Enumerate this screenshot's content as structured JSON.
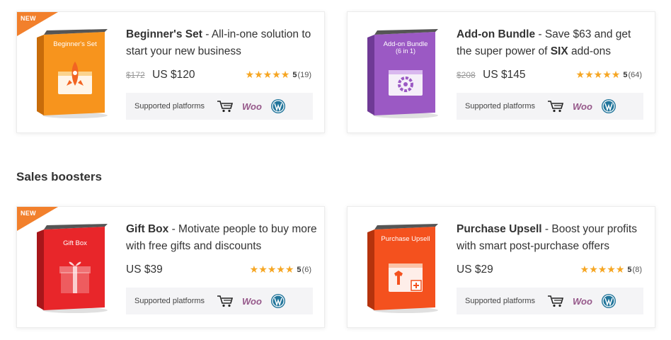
{
  "products_top": [
    {
      "badge": "NEW",
      "box_title": "Beginner's Set",
      "box_subtitle": "",
      "box_color": "#f7941d",
      "name": "Beginner's Set",
      "description": " - All-in-one solution to start your new business",
      "old_price": "$172",
      "price": "US $120",
      "rating": "5",
      "reviews": "(19)",
      "platforms_label": "Supported platforms",
      "icon": "rocket-icon"
    },
    {
      "badge": "",
      "box_title": "Add-on Bundle",
      "box_subtitle": "(6 in 1)",
      "box_color": "#9b59c4",
      "name": "Add-on Bundle",
      "description_pre": " - Save $63 and get the super power of ",
      "description_bold": "SIX",
      "description_post": " add-ons",
      "old_price": "$208",
      "price": "US $145",
      "rating": "5",
      "reviews": "(64)",
      "platforms_label": "Supported platforms",
      "icon": "gear-icon"
    }
  ],
  "section_title": "Sales boosters",
  "products_bottom": [
    {
      "badge": "NEW",
      "box_title": "Gift Box",
      "box_color": "#e8262a",
      "name": "Gift Box",
      "description": " - Motivate people to buy more with free gifts and discounts",
      "price": "US $39",
      "rating": "5",
      "reviews": "(6)",
      "platforms_label": "Supported platforms",
      "icon": "gift-icon"
    },
    {
      "badge": "",
      "box_title": "Purchase Upsell",
      "box_color": "#f4511e",
      "name": "Purchase Upsell",
      "description": " - Boost your profits with smart post-purchase offers",
      "price": "US $29",
      "rating": "5",
      "reviews": "(8)",
      "platforms_label": "Supported platforms",
      "icon": "shirt-icon"
    }
  ],
  "platform_labels": {
    "woo": "Woo"
  },
  "colors": {
    "star": "#f6a623",
    "badge": "#f2802c",
    "woo": "#96588a",
    "wordpress": "#21759b"
  }
}
